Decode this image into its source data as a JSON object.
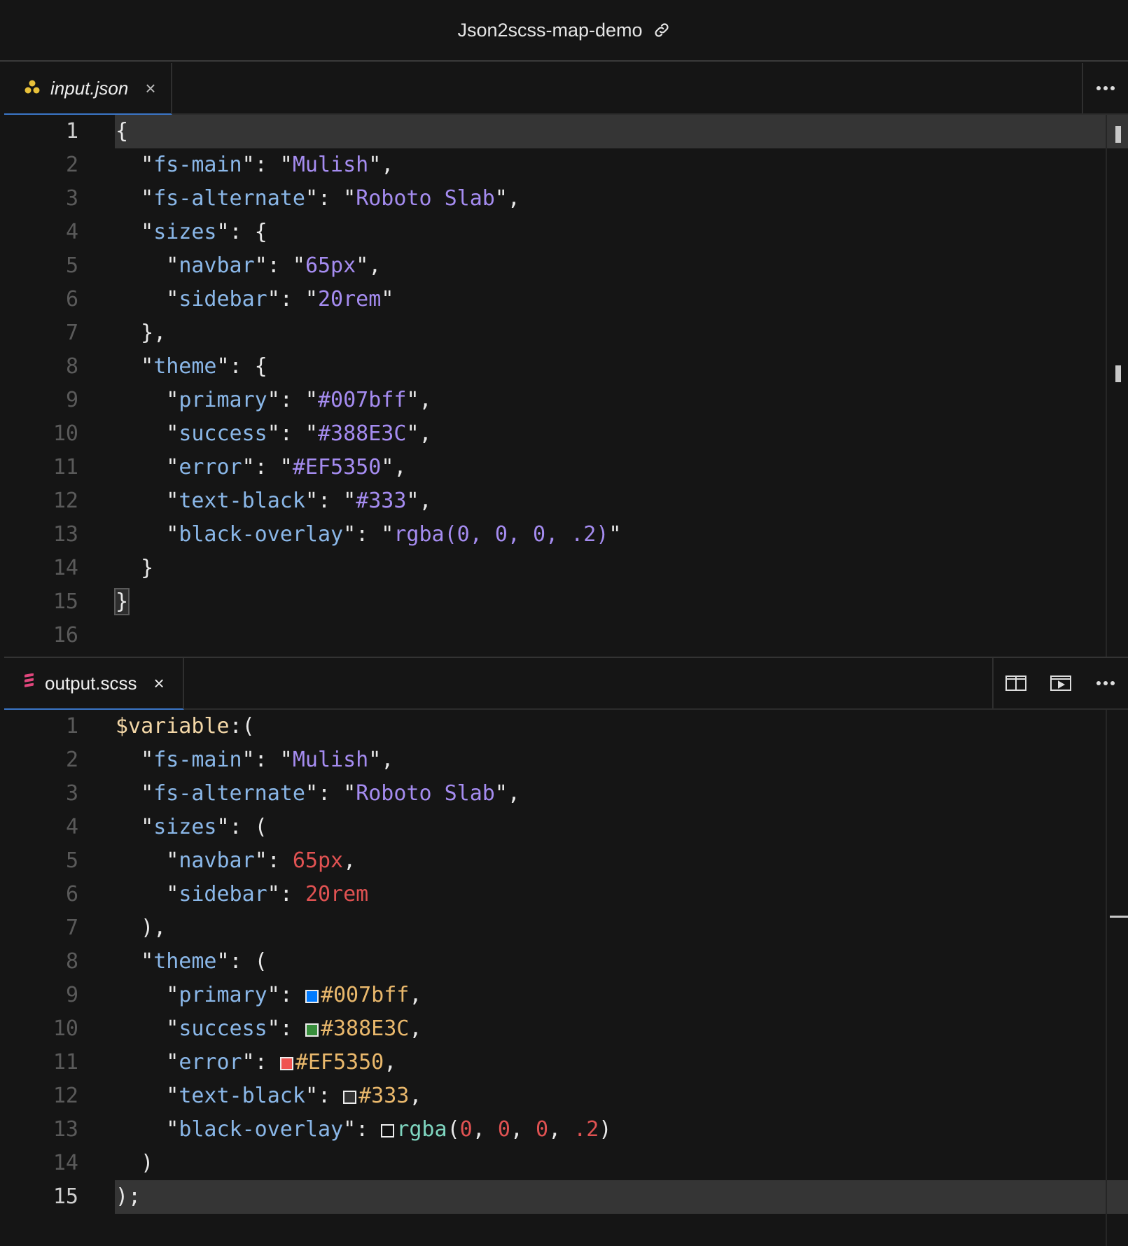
{
  "window": {
    "title": "Json2scss-map-demo",
    "title_icon": "link-icon"
  },
  "top_editor": {
    "tab": {
      "label": "input.json",
      "icon": "json-file-icon",
      "close": "×"
    },
    "more_actions_icon": "more-actions-icon",
    "current_line": 1,
    "lines": [
      {
        "n": "1",
        "tokens": [
          {
            "t": "p",
            "v": "{"
          }
        ]
      },
      {
        "n": "2",
        "tokens": [
          {
            "t": "p",
            "v": "  \""
          },
          {
            "t": "k",
            "v": "fs-main"
          },
          {
            "t": "p",
            "v": "\": \""
          },
          {
            "t": "s",
            "v": "Mulish"
          },
          {
            "t": "p",
            "v": "\","
          }
        ]
      },
      {
        "n": "3",
        "tokens": [
          {
            "t": "p",
            "v": "  \""
          },
          {
            "t": "k",
            "v": "fs-alternate"
          },
          {
            "t": "p",
            "v": "\": \""
          },
          {
            "t": "s",
            "v": "Roboto Slab"
          },
          {
            "t": "p",
            "v": "\","
          }
        ]
      },
      {
        "n": "4",
        "tokens": [
          {
            "t": "p",
            "v": "  \""
          },
          {
            "t": "k",
            "v": "sizes"
          },
          {
            "t": "p",
            "v": "\": {"
          }
        ]
      },
      {
        "n": "5",
        "tokens": [
          {
            "t": "p",
            "v": "    \""
          },
          {
            "t": "k",
            "v": "navbar"
          },
          {
            "t": "p",
            "v": "\": \""
          },
          {
            "t": "s",
            "v": "65px"
          },
          {
            "t": "p",
            "v": "\","
          }
        ]
      },
      {
        "n": "6",
        "tokens": [
          {
            "t": "p",
            "v": "    \""
          },
          {
            "t": "k",
            "v": "sidebar"
          },
          {
            "t": "p",
            "v": "\": \""
          },
          {
            "t": "s",
            "v": "20rem"
          },
          {
            "t": "p",
            "v": "\""
          }
        ]
      },
      {
        "n": "7",
        "tokens": [
          {
            "t": "p",
            "v": "  },"
          }
        ]
      },
      {
        "n": "8",
        "tokens": [
          {
            "t": "p",
            "v": "  \""
          },
          {
            "t": "k",
            "v": "theme"
          },
          {
            "t": "p",
            "v": "\": {"
          }
        ]
      },
      {
        "n": "9",
        "tokens": [
          {
            "t": "p",
            "v": "    \""
          },
          {
            "t": "k",
            "v": "primary"
          },
          {
            "t": "p",
            "v": "\": \""
          },
          {
            "t": "s",
            "v": "#007bff"
          },
          {
            "t": "p",
            "v": "\","
          }
        ]
      },
      {
        "n": "10",
        "tokens": [
          {
            "t": "p",
            "v": "    \""
          },
          {
            "t": "k",
            "v": "success"
          },
          {
            "t": "p",
            "v": "\": \""
          },
          {
            "t": "s",
            "v": "#388E3C"
          },
          {
            "t": "p",
            "v": "\","
          }
        ]
      },
      {
        "n": "11",
        "tokens": [
          {
            "t": "p",
            "v": "    \""
          },
          {
            "t": "k",
            "v": "error"
          },
          {
            "t": "p",
            "v": "\": \""
          },
          {
            "t": "s",
            "v": "#EF5350"
          },
          {
            "t": "p",
            "v": "\","
          }
        ]
      },
      {
        "n": "12",
        "tokens": [
          {
            "t": "p",
            "v": "    \""
          },
          {
            "t": "k",
            "v": "text-black"
          },
          {
            "t": "p",
            "v": "\": \""
          },
          {
            "t": "s",
            "v": "#333"
          },
          {
            "t": "p",
            "v": "\","
          }
        ]
      },
      {
        "n": "13",
        "tokens": [
          {
            "t": "p",
            "v": "    \""
          },
          {
            "t": "k",
            "v": "black-overlay"
          },
          {
            "t": "p",
            "v": "\": \""
          },
          {
            "t": "s",
            "v": "rgba(0, 0, 0, .2)"
          },
          {
            "t": "p",
            "v": "\""
          }
        ]
      },
      {
        "n": "14",
        "tokens": [
          {
            "t": "p",
            "v": "  }"
          }
        ]
      },
      {
        "n": "15",
        "tokens": [
          {
            "t": "box",
            "v": "}"
          }
        ]
      },
      {
        "n": "16",
        "tokens": []
      }
    ]
  },
  "bottom_editor": {
    "tab": {
      "label": "output.scss",
      "icon": "scss-file-icon",
      "close": "×"
    },
    "actions": [
      {
        "name": "split-editor-icon"
      },
      {
        "name": "open-preview-icon"
      },
      {
        "name": "more-actions-icon"
      }
    ],
    "current_line": 15,
    "lines": [
      {
        "n": "1",
        "tokens": [
          {
            "t": "sym",
            "v": "$variable"
          },
          {
            "t": "p",
            "v": ":("
          }
        ]
      },
      {
        "n": "2",
        "tokens": [
          {
            "t": "p",
            "v": "  \""
          },
          {
            "t": "k",
            "v": "fs-main"
          },
          {
            "t": "p",
            "v": "\": \""
          },
          {
            "t": "s",
            "v": "Mulish"
          },
          {
            "t": "p",
            "v": "\","
          }
        ]
      },
      {
        "n": "3",
        "tokens": [
          {
            "t": "p",
            "v": "  \""
          },
          {
            "t": "k",
            "v": "fs-alternate"
          },
          {
            "t": "p",
            "v": "\": \""
          },
          {
            "t": "s",
            "v": "Roboto Slab"
          },
          {
            "t": "p",
            "v": "\","
          }
        ]
      },
      {
        "n": "4",
        "tokens": [
          {
            "t": "p",
            "v": "  \""
          },
          {
            "t": "k",
            "v": "sizes"
          },
          {
            "t": "p",
            "v": "\": ("
          }
        ]
      },
      {
        "n": "5",
        "tokens": [
          {
            "t": "p",
            "v": "    \""
          },
          {
            "t": "k",
            "v": "navbar"
          },
          {
            "t": "p",
            "v": "\": "
          },
          {
            "t": "num",
            "v": "65px"
          },
          {
            "t": "p",
            "v": ","
          }
        ]
      },
      {
        "n": "6",
        "tokens": [
          {
            "t": "p",
            "v": "    \""
          },
          {
            "t": "k",
            "v": "sidebar"
          },
          {
            "t": "p",
            "v": "\": "
          },
          {
            "t": "num",
            "v": "20rem"
          }
        ]
      },
      {
        "n": "7",
        "tokens": [
          {
            "t": "p",
            "v": "  ),"
          }
        ]
      },
      {
        "n": "8",
        "tokens": [
          {
            "t": "p",
            "v": "  \""
          },
          {
            "t": "k",
            "v": "theme"
          },
          {
            "t": "p",
            "v": "\": ("
          }
        ]
      },
      {
        "n": "9",
        "tokens": [
          {
            "t": "p",
            "v": "    \""
          },
          {
            "t": "k",
            "v": "primary"
          },
          {
            "t": "p",
            "v": "\": "
          },
          {
            "t": "sw",
            "c": "#007bff"
          },
          {
            "t": "hex",
            "v": "#007bff"
          },
          {
            "t": "p",
            "v": ","
          }
        ]
      },
      {
        "n": "10",
        "tokens": [
          {
            "t": "p",
            "v": "    \""
          },
          {
            "t": "k",
            "v": "success"
          },
          {
            "t": "p",
            "v": "\": "
          },
          {
            "t": "sw",
            "c": "#388E3C"
          },
          {
            "t": "hex",
            "v": "#388E3C"
          },
          {
            "t": "p",
            "v": ","
          }
        ]
      },
      {
        "n": "11",
        "tokens": [
          {
            "t": "p",
            "v": "    \""
          },
          {
            "t": "k",
            "v": "error"
          },
          {
            "t": "p",
            "v": "\": "
          },
          {
            "t": "sw",
            "c": "#EF5350"
          },
          {
            "t": "hex",
            "v": "#EF5350"
          },
          {
            "t": "p",
            "v": ","
          }
        ]
      },
      {
        "n": "12",
        "tokens": [
          {
            "t": "p",
            "v": "    \""
          },
          {
            "t": "k",
            "v": "text-black"
          },
          {
            "t": "p",
            "v": "\": "
          },
          {
            "t": "sw",
            "c": "#333"
          },
          {
            "t": "hex",
            "v": "#333"
          },
          {
            "t": "p",
            "v": ","
          }
        ]
      },
      {
        "n": "13",
        "tokens": [
          {
            "t": "p",
            "v": "    \""
          },
          {
            "t": "k",
            "v": "black-overlay"
          },
          {
            "t": "p",
            "v": "\": "
          },
          {
            "t": "sw",
            "c": "rgba(0,0,0,.2)"
          },
          {
            "t": "fn",
            "v": "rgba"
          },
          {
            "t": "p",
            "v": "("
          },
          {
            "t": "num",
            "v": "0"
          },
          {
            "t": "p",
            "v": ", "
          },
          {
            "t": "num",
            "v": "0"
          },
          {
            "t": "p",
            "v": ", "
          },
          {
            "t": "num",
            "v": "0"
          },
          {
            "t": "p",
            "v": ", "
          },
          {
            "t": "num",
            "v": ".2"
          },
          {
            "t": "p",
            "v": ")"
          }
        ]
      },
      {
        "n": "14",
        "tokens": [
          {
            "t": "p",
            "v": "  )"
          }
        ]
      },
      {
        "n": "15",
        "tokens": [
          {
            "t": "p",
            "v": ");"
          }
        ]
      }
    ]
  },
  "colors": {
    "background": "#151515",
    "key": "#8ab7e8",
    "string": "#a58cf0",
    "number": "#e05252",
    "hex_value": "#e9b86c",
    "variable": "#f3d7a7",
    "function": "#7fd6c0",
    "current_line": "#353535",
    "tab_underline": "#3b76c7"
  }
}
